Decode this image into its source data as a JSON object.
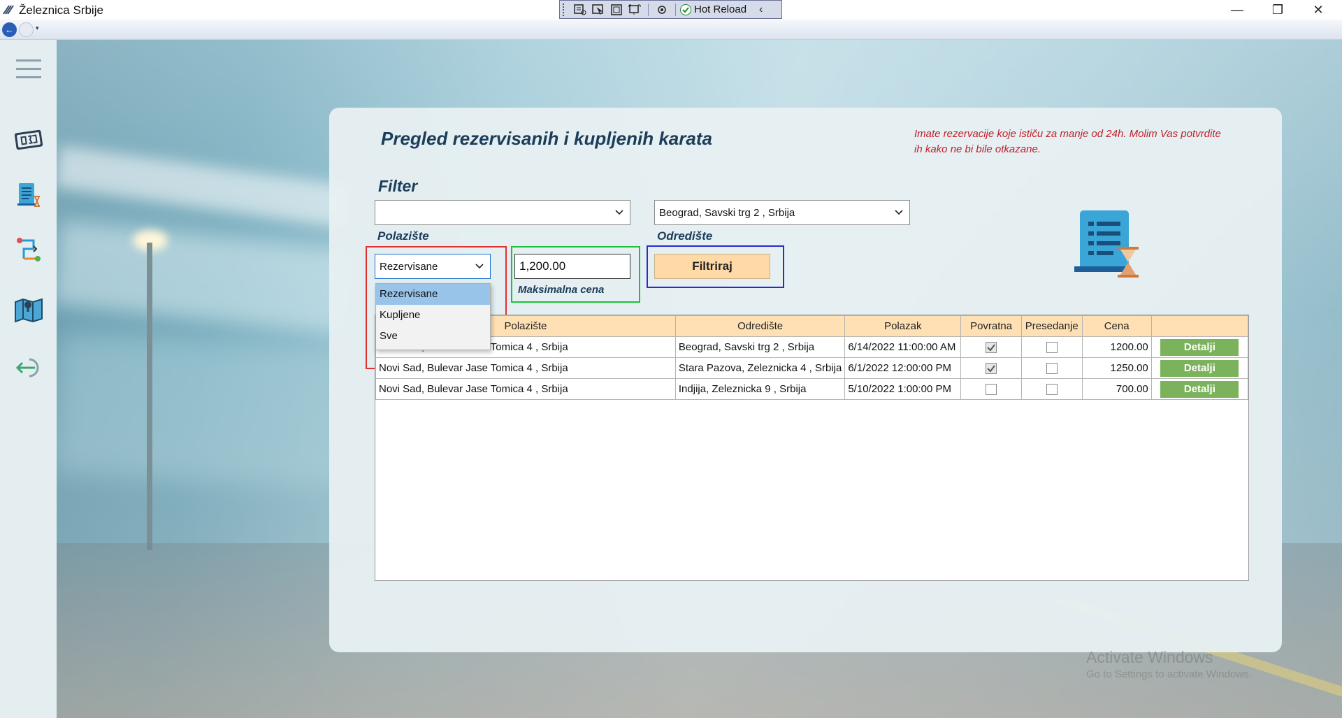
{
  "window": {
    "title": "Železnica Srbije",
    "minimize": "—",
    "maximize": "❐",
    "close": "✕"
  },
  "hot_reload": {
    "label": "Hot Reload",
    "collapse": "‹"
  },
  "nav": {
    "back": "←",
    "dropdown": "▾"
  },
  "sidebar": {
    "items": [
      {
        "icon": "hamburger-menu-icon"
      },
      {
        "icon": "ticket-icon"
      },
      {
        "icon": "reservation-list-icon"
      },
      {
        "icon": "route-icon"
      },
      {
        "icon": "map-icon"
      },
      {
        "icon": "logout-icon"
      }
    ]
  },
  "page": {
    "title": "Pregled rezervisanih i kupljenih karata",
    "warning": "Imate rezervacije koje ističu za manje od 24h. Molim Vas potvrdite ih kako ne bi bile otkazane.",
    "filter_title": "Filter"
  },
  "filter": {
    "from_value": "",
    "from_label": "Polazište",
    "to_value": "Beograd, Savski trg 2 , Srbija",
    "to_label": "Odredište",
    "type_value": "Rezervisane",
    "type_options": [
      "Rezervisane",
      "Kupljene",
      "Sve"
    ],
    "max_price_value": "1,200.00",
    "max_price_label": "Maksimalna cena",
    "filter_button": "Filtriraj"
  },
  "table": {
    "headers": [
      "Polazište",
      "Odredište",
      "Polazak",
      "Povratna",
      "Presedanje",
      "Cena",
      ""
    ],
    "rows": [
      {
        "from": "Novi Sad, Bulevar Jase Tomica 4 , Srbija",
        "to": "Beograd, Savski trg 2 , Srbija",
        "departure": "6/14/2022 11:00:00 AM",
        "return": true,
        "transfer": false,
        "price": "1200.00",
        "action": "Detalji"
      },
      {
        "from": "Novi Sad, Bulevar Jase Tomica 4 , Srbija",
        "to": "Stara Pazova, Zeleznicka 4 , Srbija",
        "departure": "6/1/2022 12:00:00 PM",
        "return": true,
        "transfer": false,
        "price": "1250.00",
        "action": "Detalji"
      },
      {
        "from": "Novi Sad, Bulevar Jase Tomica 4 , Srbija",
        "to": "Indjija, Zeleznicka 9 , Srbija",
        "departure": "5/10/2022 1:00:00 PM",
        "return": false,
        "transfer": false,
        "price": "700.00",
        "action": "Detalji"
      }
    ]
  },
  "watermark": {
    "line1": "Activate Windows",
    "line2": "Go to Settings to activate Windows."
  },
  "colors": {
    "title": "#1c3d5a",
    "warning": "#c0202a",
    "header_bg": "#ffe0b4",
    "filter_button_bg": "#ffd9a6",
    "detail_button_bg": "#7bb35c"
  }
}
